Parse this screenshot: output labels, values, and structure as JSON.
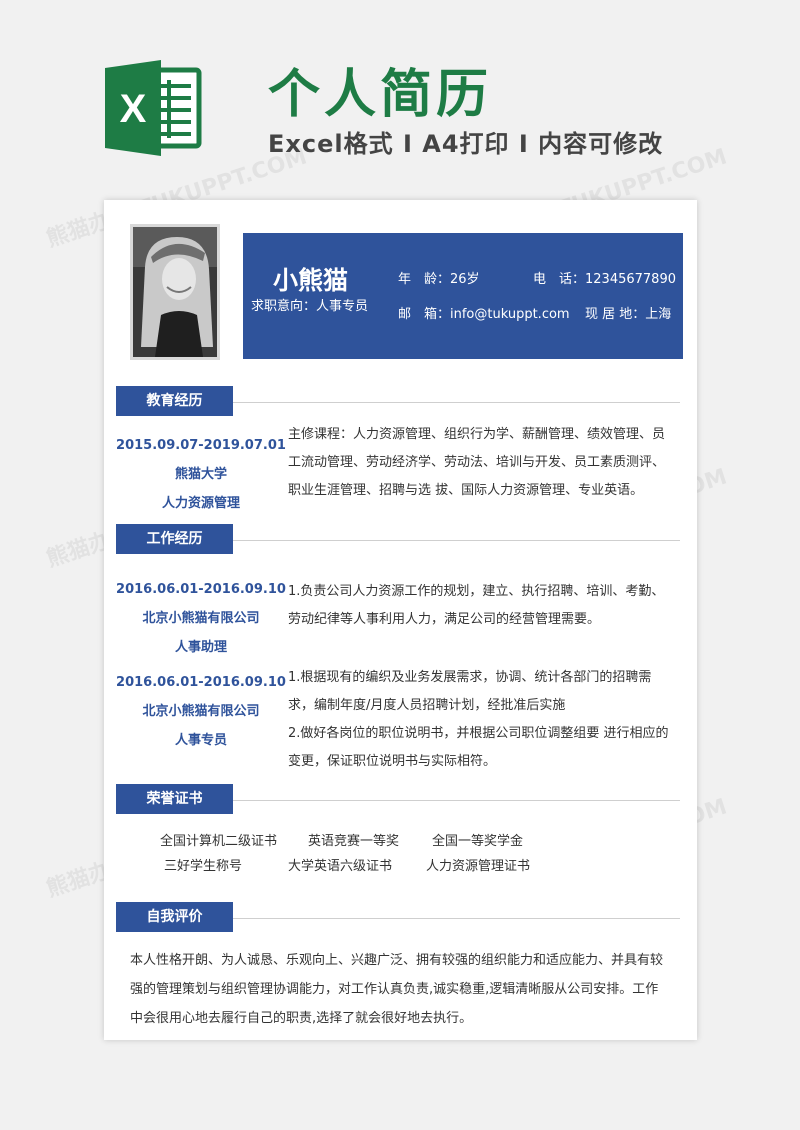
{
  "banner": {
    "title": "个人简历",
    "subtitle": "Excel格式 I A4打印 I 内容可修改",
    "logo_letter": "X",
    "watermark": "熊猫办公 TUKUPPT.COM"
  },
  "profile": {
    "name": "小熊猫",
    "intent": "求职意向：人事专员",
    "age": "年　龄：26岁",
    "phone": "电　话：12345677890",
    "email": "邮　箱：info@tukuppt.com",
    "location": "现 居 地：上海"
  },
  "sections": {
    "education": "教育经历",
    "work": "工作经历",
    "honors": "荣誉证书",
    "self": "自我评价"
  },
  "education": {
    "period": "2015.09.07-2019.07.01",
    "school": "熊猫大学",
    "major": "人力资源管理",
    "courses": "主修课程：人力资源管理、组织行为学、薪酬管理、绩效管理、员工流动管理、劳动经济学、劳动法、培训与开发、员工素质测评、职业生涯管理、招聘与选 拔、国际人力资源管理、专业英语。"
  },
  "work": [
    {
      "period": "2016.06.01-2016.09.10",
      "company": "北京小熊猫有限公司",
      "role": "人事助理",
      "desc": "1.负责公司人力资源工作的规划，建立、执行招聘、培训、考勤、劳动纪律等人事利用人力，满足公司的经营管理需要。"
    },
    {
      "period": "2016.06.01-2016.09.10",
      "company": "北京小熊猫有限公司",
      "role": "人事专员",
      "desc": "1.根据现有的编织及业务发展需求，协调、统计各部门的招聘需求，编制年度/月度人员招聘计划，经批准后实施",
      "desc2": "2.做好各岗位的职位说明书，并根据公司职位调整组要 进行相应的变更，保证职位说明书与实际相符。"
    }
  ],
  "honors": [
    "全国计算机二级证书",
    "英语竞赛一等奖",
    "全国一等奖学金",
    "三好学生称号",
    "大学英语六级证书",
    "人力资源管理证书"
  ],
  "self_eval": "本人性格开朗、为人诚恳、乐观向上、兴趣广泛、拥有较强的组织能力和适应能力、并具有较强的管理策划与组织管理协调能力，对工作认真负责,诚实稳重,逻辑清晰服从公司安排。工作中会很用心地去履行自己的职责,选择了就会很好地去执行。",
  "colors": {
    "accent": "#2f539b",
    "excel_green": "#1e7c45"
  }
}
